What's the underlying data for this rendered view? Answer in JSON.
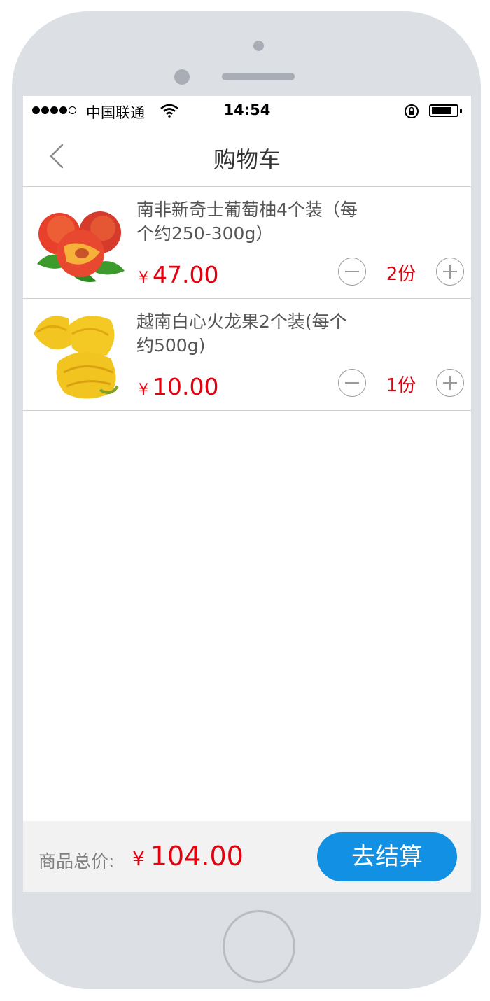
{
  "status_bar": {
    "carrier": "中国联通",
    "time": "14:54",
    "signal_bars": 4,
    "battery_level": 0.8
  },
  "navbar": {
    "title": "购物车",
    "back_icon": "chevron-left-icon"
  },
  "cart": {
    "items": [
      {
        "name": "南非新奇士葡萄柚4个装（每个约250-300g）",
        "currency": "¥",
        "price": "47.00",
        "quantity": "2份",
        "image": "peach-image"
      },
      {
        "name": "越南白心火龙果2个装(每个约500g)",
        "currency": "¥",
        "price": "10.00",
        "quantity": "1份",
        "image": "starfruit-image"
      }
    ]
  },
  "footer": {
    "total_label": "商品总价:",
    "currency": "¥",
    "total": "104.00",
    "checkout_label": "去结算"
  },
  "colors": {
    "accent_red": "#e4000d",
    "checkout_blue": "#1290e3",
    "phone_frame": "#dcdfe4"
  }
}
